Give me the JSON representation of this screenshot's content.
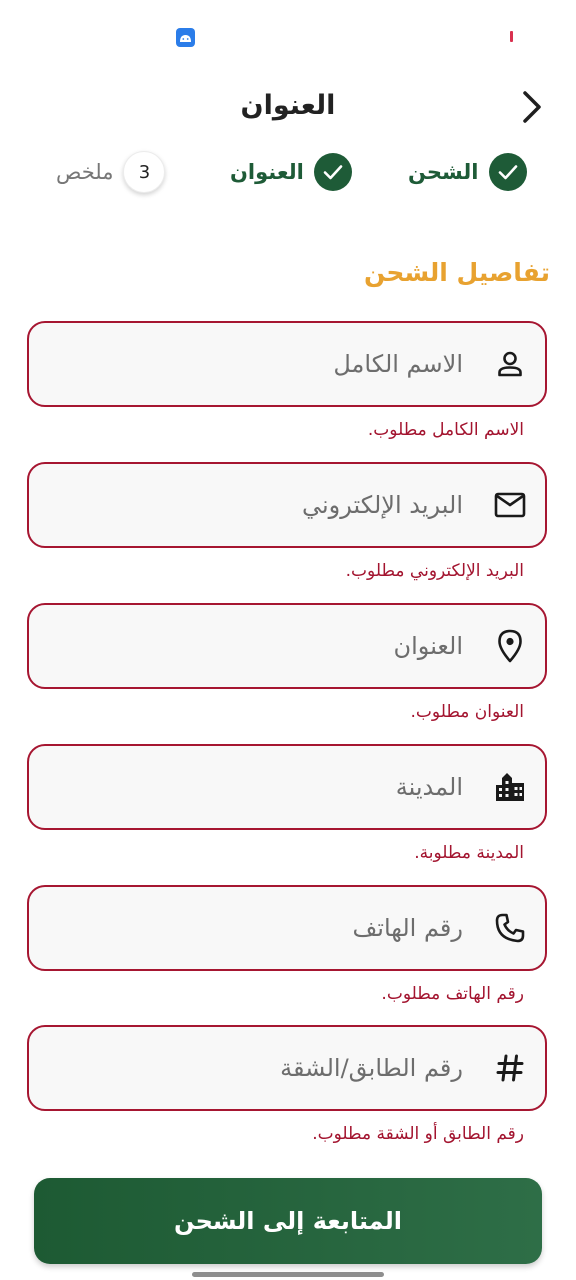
{
  "header": {
    "title": "العنوان"
  },
  "stepper": {
    "steps": [
      {
        "label": "الشحن",
        "state": "done"
      },
      {
        "label": "العنوان",
        "state": "done"
      },
      {
        "label": "ملخص",
        "number": "3",
        "state": "pending"
      }
    ]
  },
  "section": {
    "title": "تفاصيل الشحن"
  },
  "fields": [
    {
      "icon": "person-icon",
      "placeholder": "الاسم الكامل",
      "value": "",
      "error": "الاسم الكامل مطلوب."
    },
    {
      "icon": "mail-icon",
      "placeholder": "البريد الإلكتروني",
      "value": "",
      "error": "البريد الإلكتروني مطلوب."
    },
    {
      "icon": "location-pin-icon",
      "placeholder": "العنوان",
      "value": "",
      "error": "العنوان مطلوب."
    },
    {
      "icon": "city-icon",
      "placeholder": "المدينة",
      "value": "",
      "error": "المدينة مطلوبة."
    },
    {
      "icon": "phone-icon",
      "placeholder": "رقم الهاتف",
      "value": "",
      "error": "رقم الهاتف مطلوب."
    },
    {
      "icon": "hash-icon",
      "placeholder": "رقم الطابق/الشقة",
      "value": "",
      "error": "رقم الطابق أو الشقة مطلوب."
    }
  ],
  "actions": {
    "continue_label": "المتابعة إلى الشحن"
  },
  "colors": {
    "primary": "#1e5b37",
    "accent": "#e8a230",
    "error": "#a61631",
    "field_background": "#f8f8f8"
  }
}
